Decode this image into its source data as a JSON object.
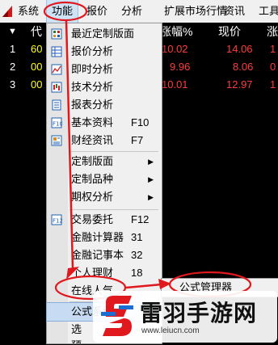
{
  "menubar": {
    "items": [
      {
        "label": "系统"
      },
      {
        "label": "功能"
      },
      {
        "label": "报价"
      },
      {
        "label": "分析"
      },
      {
        "label": "扩展市场行情"
      },
      {
        "label": "资讯"
      },
      {
        "label": "工具"
      }
    ]
  },
  "table": {
    "sort_arrow": "▼",
    "headers": {
      "code": "代",
      "change_pct": "涨幅%",
      "price": "现价",
      "rise": "涨"
    },
    "rows": [
      {
        "num": "1",
        "code": "60",
        "change_pct": "10.02",
        "price": "14.06",
        "rise": "1"
      },
      {
        "num": "2",
        "code": "00",
        "change_pct": "9.96",
        "price": "8.06",
        "rise": "0"
      },
      {
        "num": "3",
        "code": "00",
        "change_pct": "10.01",
        "price": "12.97",
        "rise": "1"
      }
    ]
  },
  "menu": {
    "items": [
      {
        "label": "最近定制版面",
        "icon": "grid-icon"
      },
      {
        "label": "报价分析",
        "icon": "table-icon"
      },
      {
        "label": "即时分析",
        "icon": "line-chart-icon"
      },
      {
        "label": "技术分析",
        "icon": "candlestick-icon"
      },
      {
        "label": "报表分析",
        "icon": "report-icon"
      },
      {
        "label": "基本资料",
        "shortcut": "F10",
        "icon": "f10-icon"
      },
      {
        "label": "财经资讯",
        "shortcut": "F7",
        "icon": "news-icon"
      },
      {
        "label": "定制版面"
      },
      {
        "label": "定制品种"
      },
      {
        "label": "期权分析"
      },
      {
        "label": "交易委托",
        "shortcut": "F12",
        "icon": "f12-icon"
      },
      {
        "label": "金融计算器",
        "shortcut": "31"
      },
      {
        "label": "金融记事本",
        "shortcut": "32"
      },
      {
        "label": "个人理财",
        "shortcut": "18"
      },
      {
        "label": "在线人气"
      },
      {
        "label": "公式系统"
      },
      {
        "label": "选"
      },
      {
        "label": "预"
      },
      {
        "label": "自"
      }
    ],
    "submenu_arrow": "▶"
  },
  "submenu": {
    "label": "公式管理器"
  },
  "watermark": {
    "title": "雷羽手游网",
    "url": "www.leiucn.com"
  },
  "colors": {
    "annotation": "#e0191e",
    "highlight": "#c7dcf2",
    "up": "#ff3b3b",
    "code": "#ffff00"
  }
}
